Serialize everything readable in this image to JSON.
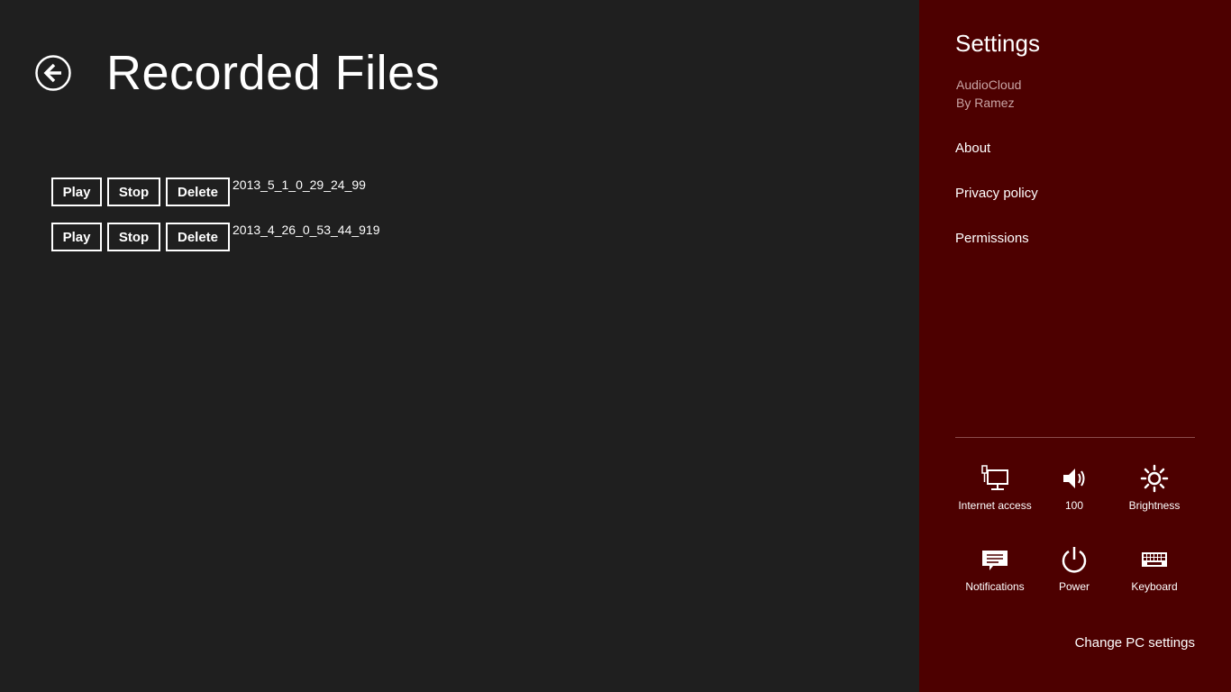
{
  "page": {
    "title": "Recorded Files"
  },
  "files": [
    {
      "name": "2013_5_1_0_29_24_99",
      "play": "Play",
      "stop": "Stop",
      "delete": "Delete"
    },
    {
      "name": "2013_4_26_0_53_44_919",
      "play": "Play",
      "stop": "Stop",
      "delete": "Delete"
    }
  ],
  "settings": {
    "title": "Settings",
    "app_name": "AudioCloud",
    "app_by": "By Ramez",
    "menu": [
      "About",
      "Privacy policy",
      "Permissions"
    ],
    "tiles": [
      {
        "label": "Internet access",
        "icon": "network-icon"
      },
      {
        "label": "100",
        "icon": "volume-icon"
      },
      {
        "label": "Brightness",
        "icon": "brightness-icon"
      },
      {
        "label": "Notifications",
        "icon": "notifications-icon"
      },
      {
        "label": "Power",
        "icon": "power-icon"
      },
      {
        "label": "Keyboard",
        "icon": "keyboard-icon"
      }
    ],
    "change_pc_settings": "Change PC settings"
  },
  "colors": {
    "app_background": "#1f1f1f",
    "charm_background": "#4d0000",
    "text": "#ffffff",
    "subtext": "#c9a4a4"
  }
}
